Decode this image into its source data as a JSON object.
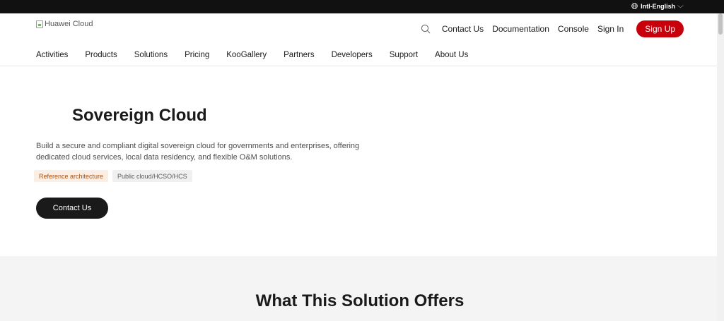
{
  "topbar": {
    "language": "Intl-English",
    "globe_icon": "globe-icon",
    "chevron_icon": "chevron-down-icon"
  },
  "header": {
    "logo_alt": "Huawei Cloud",
    "search_icon": "search-icon",
    "links": [
      "Contact Us",
      "Documentation",
      "Console",
      "Sign In"
    ],
    "signup_label": "Sign Up",
    "signup_color": "#c7000b"
  },
  "nav": {
    "items": [
      "Activities",
      "Products",
      "Solutions",
      "Pricing",
      "KooGallery",
      "Partners",
      "Developers",
      "Support",
      "About Us"
    ]
  },
  "hero": {
    "title": "Sovereign Cloud",
    "description": "Build a secure and compliant digital sovereign cloud for governments and enterprises, offering dedicated cloud services, local data residency, and flexible O&M solutions.",
    "tags": [
      "Reference architecture",
      "Public cloud/HCSO/HCS"
    ],
    "cta_label": "Contact Us"
  },
  "offers": {
    "title": "What This Solution Offers"
  }
}
